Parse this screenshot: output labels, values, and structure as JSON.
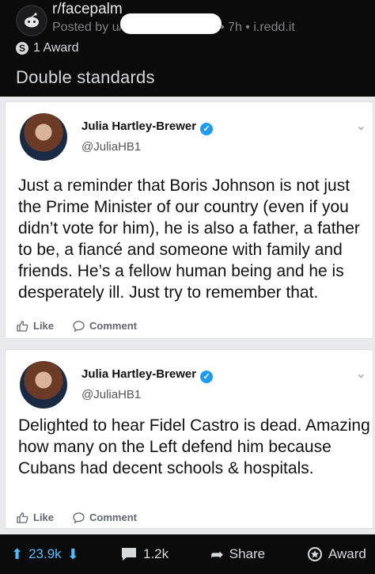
{
  "post": {
    "subreddit": "r/facepalm",
    "posted_by_prefix": "Posted by u/",
    "age_domain": "• 7h • i.redd.it",
    "awards": "1 Award",
    "award_coin": "S",
    "title": "Double standards"
  },
  "tweets": [
    {
      "name": "Julia Hartley-Brewer",
      "handle": "@JuliaHB1",
      "text": "Just a reminder that Boris Johnson is not just the Prime Minister of our country (even if you didn’t vote for him), he is also a father, a father to be, a fiancé and someone with family and friends. He’s a fellow human being and he is desperately ill. Just try to remember that.",
      "like": "Like",
      "comment": "Comment"
    },
    {
      "name": "Julia Hartley-Brewer",
      "handle": "@JuliaHB1",
      "text": "Delighted to hear Fidel Castro is dead. Amazing how many on the Left defend him because Cubans had decent schools & hospitals.",
      "like": "Like",
      "comment": "Comment"
    }
  ],
  "bottom_bar": {
    "votes": "23.9k",
    "comments": "1.2k",
    "share": "Share",
    "award": "Award"
  },
  "colors": {
    "background": "#0b0b0c",
    "verified": "#1d9bf0",
    "upvote": "#4fbcff"
  }
}
